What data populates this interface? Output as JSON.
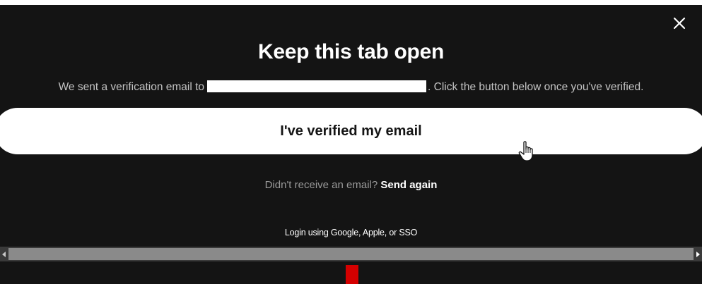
{
  "dialog": {
    "close_icon": "close-icon",
    "title": "Keep this tab open",
    "message_before": "We sent a verification email to",
    "message_after": ". Click the button below once you've verified.",
    "primary_button_label": "I've verified my email",
    "resend_prompt": "Didn't receive an email?",
    "resend_link": "Send again",
    "alt_login_link": "Login using Google, Apple, or SSO"
  },
  "icons": {
    "close": "close-icon",
    "cursor": "hand-pointer-cursor-icon",
    "scroll_left": "scroll-left-arrow-icon",
    "scroll_right": "scroll-right-arrow-icon"
  },
  "colors": {
    "background": "#141414",
    "title_text": "#ffffff",
    "body_text": "#c4c4c4",
    "muted_text": "#9a9a9a",
    "button_bg": "#ffffff",
    "button_text": "#151515",
    "accent_red": "#d50000"
  }
}
